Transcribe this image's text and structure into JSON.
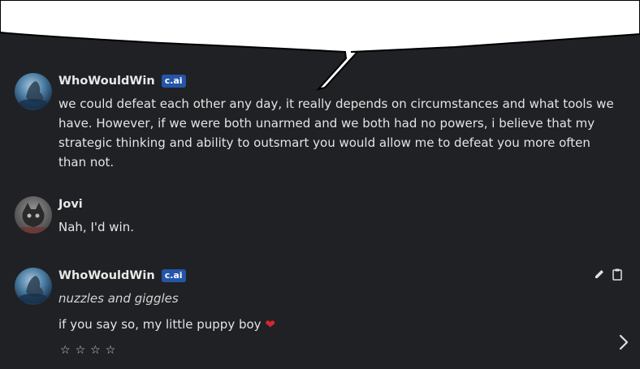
{
  "messages": [
    {
      "author": "WhoWouldWin",
      "badge": "c.ai",
      "text": "we could defeat each other any day, it really depends on circumstances and what tools we have. However, if we were both unarmed and we both had no powers, i believe that my strategic thinking and ability to outsmart you would allow me to defeat you more often than not."
    },
    {
      "author": "Jovi",
      "text": "Nah, I'd win."
    },
    {
      "author": "WhoWouldWin",
      "badge": "c.ai",
      "action": "nuzzles and giggles",
      "text": "if you say so, my little puppy boy",
      "rating_stars": 4,
      "rating_value": 0
    }
  ],
  "icons": {
    "edit": "pencil-icon",
    "copy": "clipboard-icon",
    "next": "chevron-right-icon",
    "heart": "heart-icon",
    "star": "star-outline-icon"
  },
  "colors": {
    "background": "#202124",
    "badge": "#2455a8",
    "heart": "#d9262c"
  }
}
